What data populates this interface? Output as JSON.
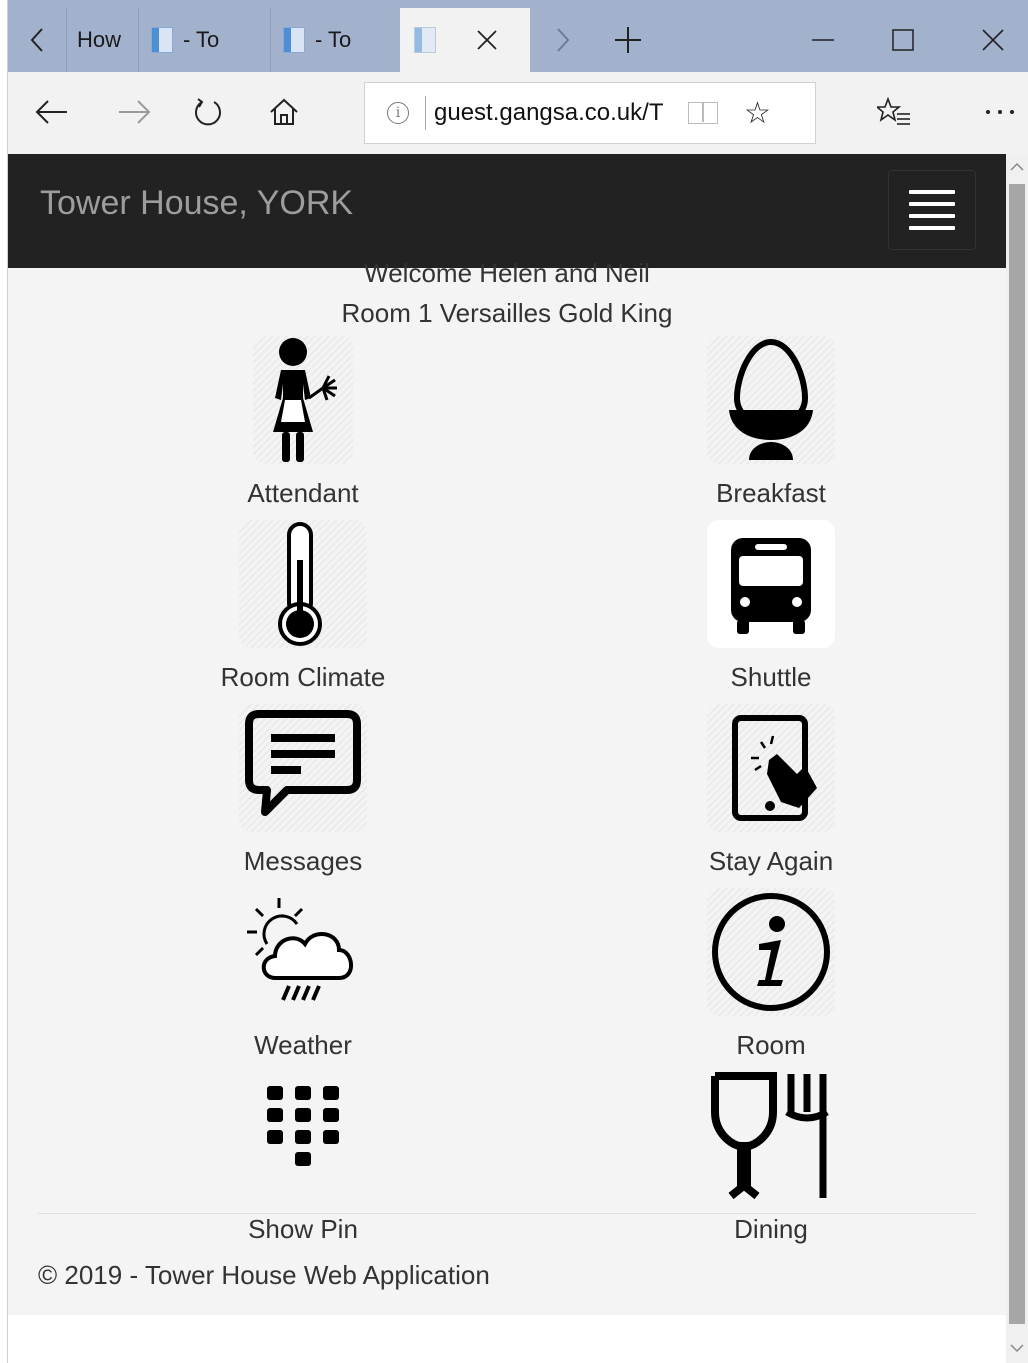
{
  "browser": {
    "tabs": [
      {
        "label": "How"
      },
      {
        "label": "- To"
      },
      {
        "label": "- To"
      },
      {
        "label": ""
      }
    ],
    "url": "guest.gangsa.co.uk/T"
  },
  "header": {
    "brand": "Tower House, YORK"
  },
  "welcome": {
    "greeting": "Welcome Helen and Neil",
    "room": "Room 1 Versailles Gold King"
  },
  "tiles": [
    {
      "label": "Attendant",
      "icon": "maid-icon"
    },
    {
      "label": "Breakfast",
      "icon": "egg-cup-icon"
    },
    {
      "label": "Room Climate",
      "icon": "thermometer-icon"
    },
    {
      "label": "Shuttle",
      "icon": "bus-icon"
    },
    {
      "label": "Messages",
      "icon": "speech-bubble-icon"
    },
    {
      "label": "Stay Again",
      "icon": "tablet-touch-icon"
    },
    {
      "label": "Weather",
      "icon": "sun-cloud-rain-icon"
    },
    {
      "label": "Room",
      "icon": "info-icon"
    },
    {
      "label": "Show Pin",
      "icon": "keypad-icon"
    },
    {
      "label": "Dining",
      "icon": "glass-fork-icon"
    }
  ],
  "footer": {
    "text": "© 2019 - Tower House Web Application"
  }
}
